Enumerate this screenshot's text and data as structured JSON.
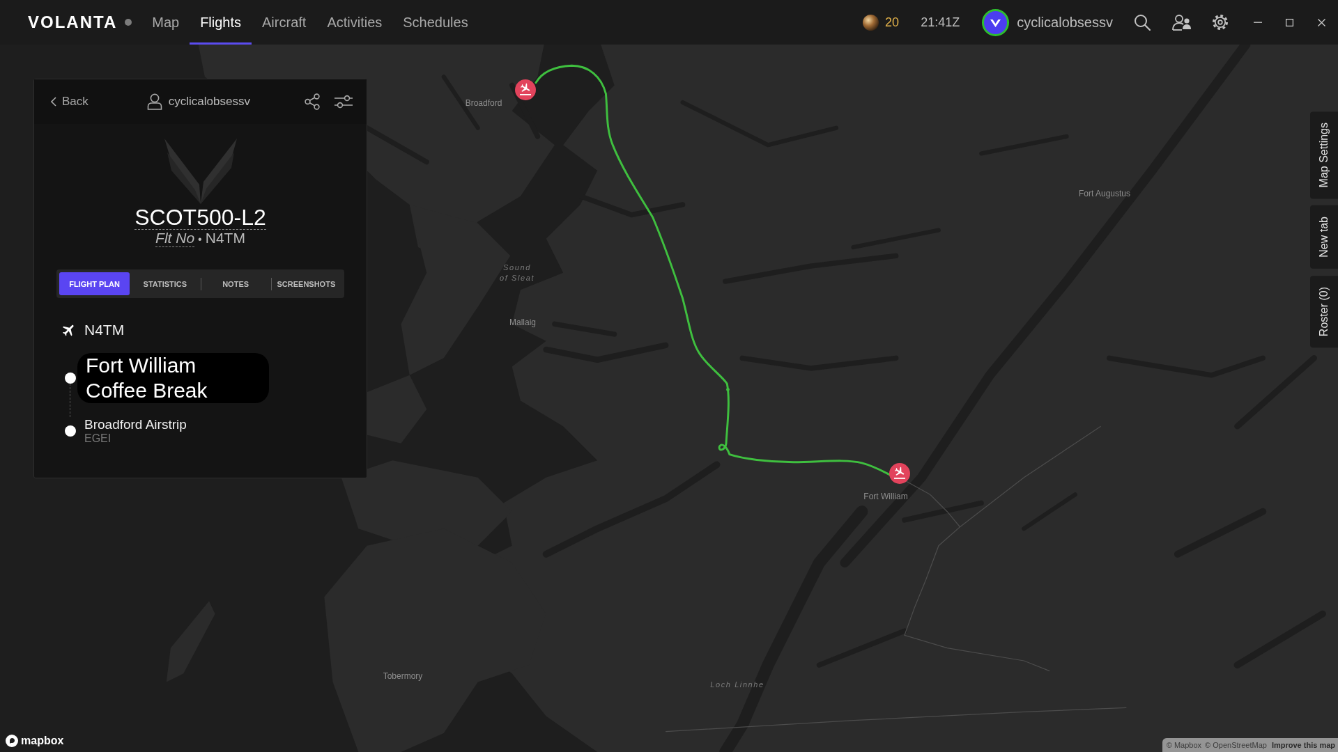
{
  "app_bar": {
    "logo": "VOLANTA",
    "nav": [
      {
        "label": "Map",
        "selected": false
      },
      {
        "label": "Flights",
        "selected": true
      },
      {
        "label": "Aircraft",
        "selected": false
      },
      {
        "label": "Activities",
        "selected": false
      },
      {
        "label": "Schedules",
        "selected": false
      }
    ],
    "coins": "20",
    "time": "21:41Z",
    "username": "cyclicalobsessv"
  },
  "flight_panel": {
    "back": "Back",
    "username": "cyclicalobsessv",
    "callsign": "SCOT500-L2",
    "flight_number_label": "Flt No",
    "separator": "•",
    "registration": "N4TM",
    "tabs": [
      {
        "label": "FLIGHT PLAN",
        "selected": true
      },
      {
        "label": "STATISTICS",
        "selected": false
      },
      {
        "label": "NOTES",
        "selected": false
      },
      {
        "label": "SCREENSHOTS",
        "selected": false
      }
    ],
    "aircraft": "N4TM",
    "waypoints": [
      {
        "kind": "custom",
        "name": "Fort William Coffee Break"
      },
      {
        "kind": "airport",
        "name": "Broadford Airstrip",
        "code": "EGEI"
      }
    ]
  },
  "map": {
    "labels": [
      {
        "kind": "town",
        "text": "Broadford"
      },
      {
        "kind": "water",
        "text": "Sound of Sleat"
      },
      {
        "kind": "town",
        "text": "Mallaig"
      },
      {
        "kind": "town",
        "text": "Fort Augustus"
      },
      {
        "kind": "town",
        "text": "Fort William"
      },
      {
        "kind": "town",
        "text": "Tobermory"
      },
      {
        "kind": "water",
        "text": "Loch Linnhe"
      }
    ]
  },
  "side_tabs": [
    {
      "label": "Map Settings"
    },
    {
      "label": "New tab"
    },
    {
      "label": "Roster (0)"
    }
  ],
  "map_footer": {
    "logo": "mapbox",
    "attribution_links": [
      "© Mapbox",
      "© OpenStreetMap"
    ],
    "improve_link": "Improve this map"
  }
}
